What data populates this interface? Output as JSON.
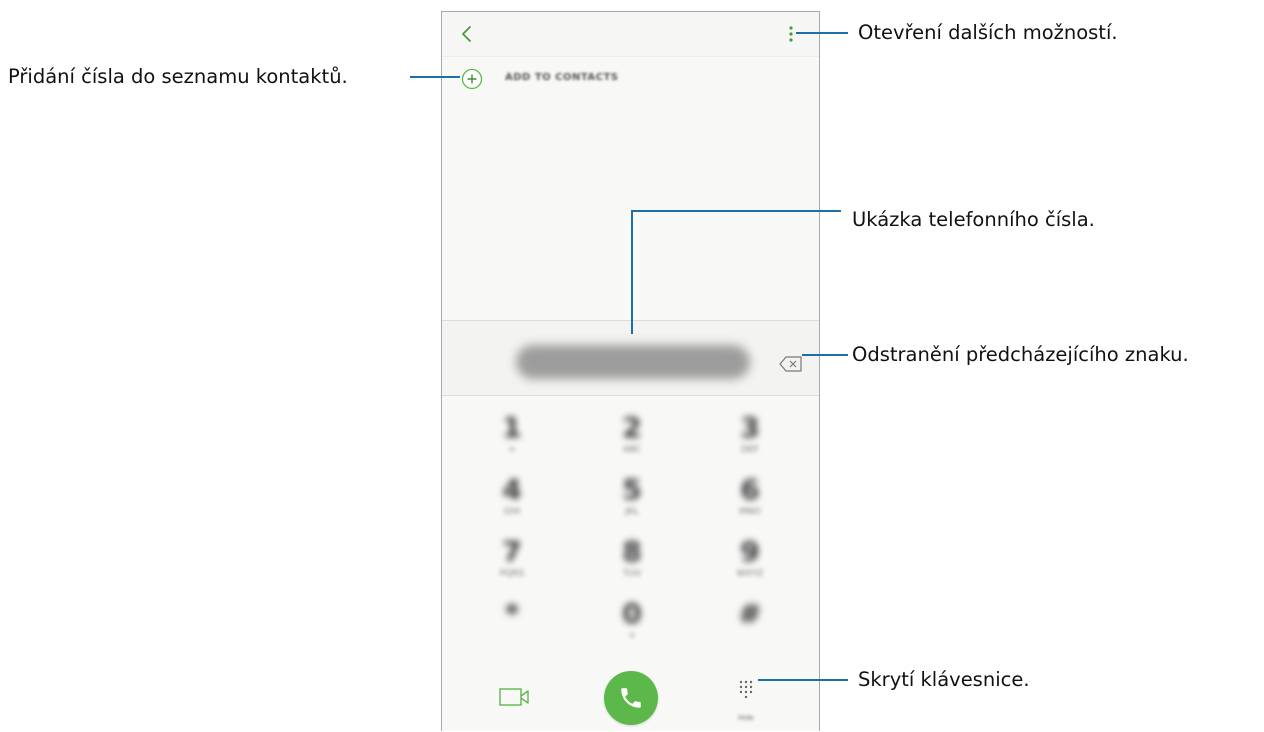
{
  "app": {
    "add_to_contacts_label": "ADD TO CONTACTS",
    "keypad": [
      {
        "digit": "1",
        "letters": "∞"
      },
      {
        "digit": "2",
        "letters": "ABC"
      },
      {
        "digit": "3",
        "letters": "DEF"
      },
      {
        "digit": "4",
        "letters": "GHI"
      },
      {
        "digit": "5",
        "letters": "JKL"
      },
      {
        "digit": "6",
        "letters": "MNO"
      },
      {
        "digit": "7",
        "letters": "PQRS"
      },
      {
        "digit": "8",
        "letters": "TUV"
      },
      {
        "digit": "9",
        "letters": "WXYZ"
      },
      {
        "digit": "*",
        "letters": ""
      },
      {
        "digit": "0",
        "letters": "+"
      },
      {
        "digit": "#",
        "letters": ""
      }
    ],
    "hide_label": "Hide",
    "icons": {
      "back": "chevron-left-icon",
      "more": "more-vertical-icon",
      "add": "plus-circle-icon",
      "backspace": "backspace-icon",
      "video": "video-call-icon",
      "call": "phone-icon",
      "keypad": "dialpad-icon"
    },
    "colors": {
      "accent": "#5cb84a",
      "callout_line": "#1e6fa8",
      "frame": "#a9a9a9"
    }
  },
  "callouts": {
    "more_options": "Otevření dalších možností.",
    "add_to_contacts": "Přidání čísla do seznamu kontaktů.",
    "number_preview": "Ukázka telefonního čísla.",
    "delete_char": "Odstranění předcházejícího znaku.",
    "hide_keypad": "Skrytí klávesnice."
  }
}
